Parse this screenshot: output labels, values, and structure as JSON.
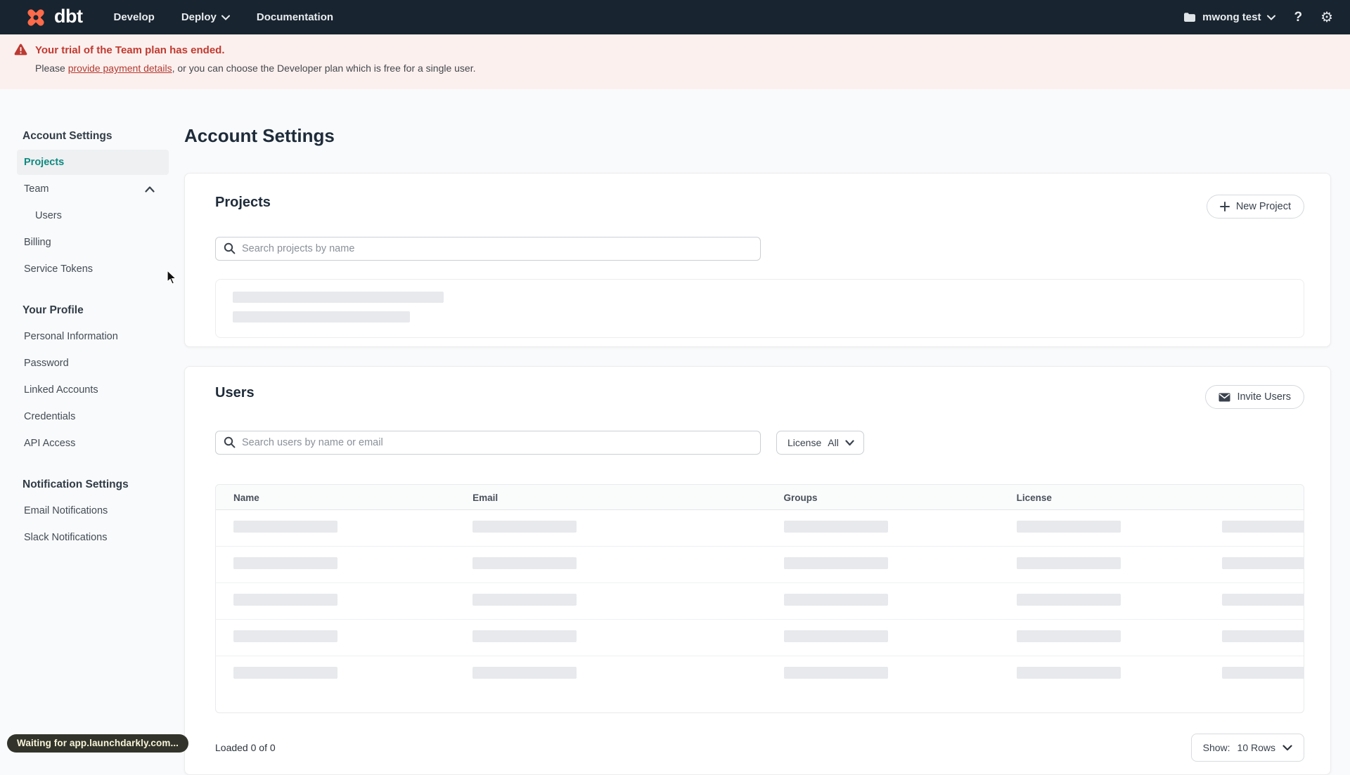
{
  "colors": {
    "nav_bg": "#18242f",
    "brand_orange": "#ff6b4a",
    "accent_teal": "#0e8a80",
    "banner_bg": "#fcf0ee",
    "banner_red": "#c03a30",
    "skeleton_gray": "#e7e9ec"
  },
  "nav": {
    "logo_text": "dbt",
    "develop": "Develop",
    "deploy": "Deploy",
    "documentation": "Documentation",
    "account_name": "mwong test",
    "help_glyph": "?",
    "gear_glyph": "⚙"
  },
  "banner": {
    "title": "Your trial of the Team plan has ended.",
    "body_prefix": "Please ",
    "link_text": "provide payment details",
    "body_suffix": ", or you can choose the Developer plan which is free for a single user."
  },
  "sidebar": {
    "sections": [
      {
        "header": "Account Settings",
        "items": [
          {
            "label": "Projects"
          },
          {
            "label": "Team"
          },
          {
            "label": "Users"
          },
          {
            "label": "Billing"
          },
          {
            "label": "Service Tokens"
          }
        ]
      },
      {
        "header": "Your Profile",
        "items": [
          {
            "label": "Personal Information"
          },
          {
            "label": "Password"
          },
          {
            "label": "Linked Accounts"
          },
          {
            "label": "Credentials"
          },
          {
            "label": "API Access"
          }
        ]
      },
      {
        "header": "Notification Settings",
        "items": [
          {
            "label": "Email Notifications"
          },
          {
            "label": "Slack Notifications"
          }
        ]
      }
    ]
  },
  "main": {
    "page_title": "Account Settings",
    "projects": {
      "title": "Projects",
      "new_project_button": "New Project",
      "search_placeholder": "Search projects by name"
    },
    "users": {
      "title": "Users",
      "invite_button": "Invite Users",
      "search_placeholder": "Search users by name or email",
      "license_filter": {
        "label": "License",
        "value": "All"
      },
      "table_columns": [
        "Name",
        "Email",
        "Groups",
        "License"
      ],
      "skeleton_row_count": 5,
      "footer": {
        "loaded_text": "Loaded 0 of 0",
        "show_label": "Show:",
        "show_value": "10 Rows"
      }
    }
  },
  "status_tooltip": "Waiting for app.launchdarkly.com..."
}
